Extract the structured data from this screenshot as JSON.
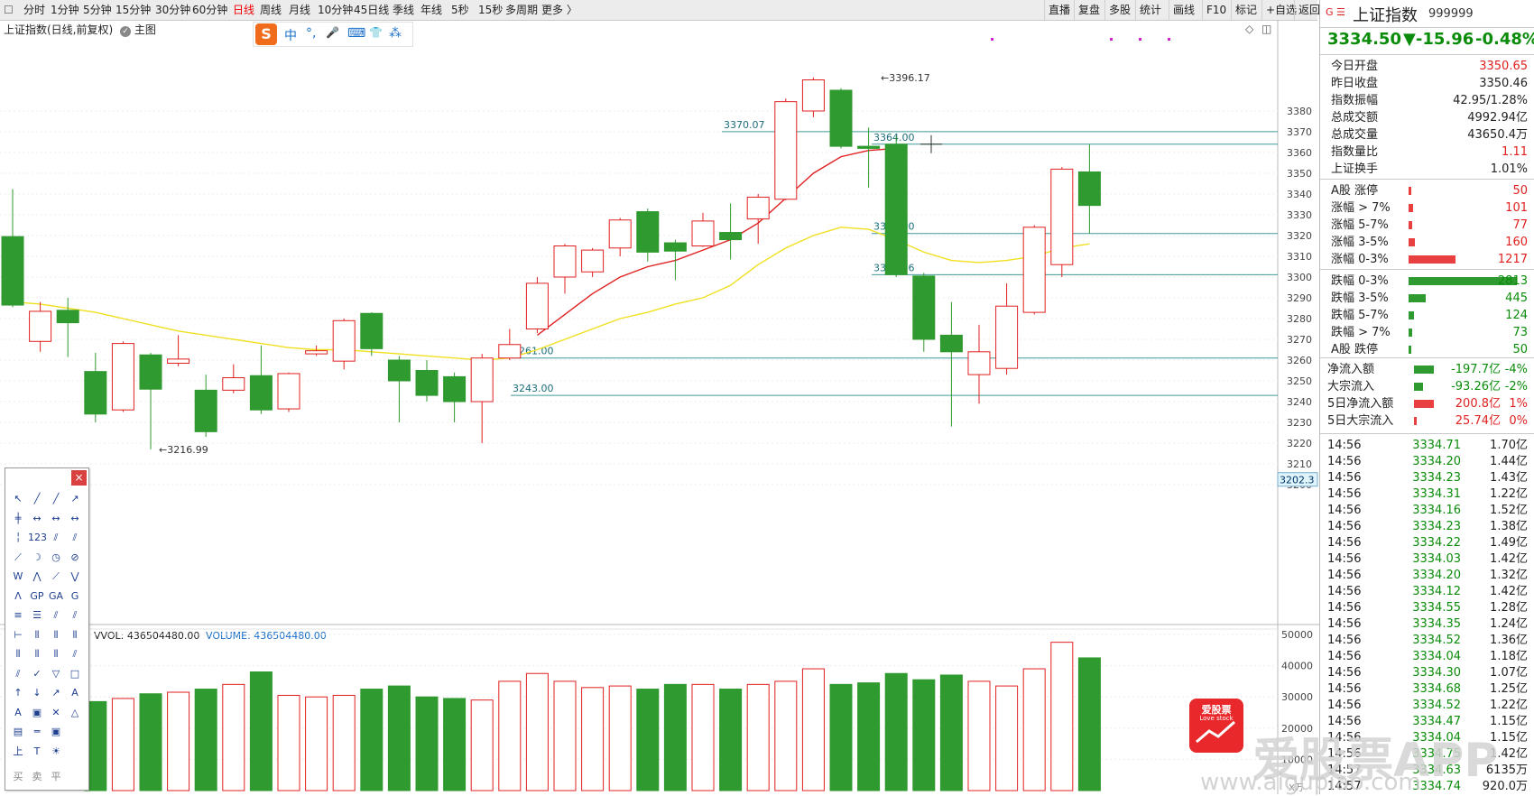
{
  "toolbar": {
    "periods": [
      "分时",
      "1分钟",
      "5分钟",
      "15分钟",
      "30分钟",
      "60分钟",
      "日线",
      "周线",
      "月线",
      "10分钟",
      "45日线",
      "季线",
      "年线",
      "5秒",
      "15秒",
      "多周期",
      "更多 〉"
    ],
    "active_period": "日线",
    "right_buttons": [
      "直播",
      "复盘",
      "多股",
      "统计",
      "画线",
      "F10",
      "标记",
      "+自选",
      "返回"
    ]
  },
  "chart": {
    "title": "上证指数(日线,前复权)",
    "main_label": "主图",
    "candles": [
      {
        "o": 3319.5,
        "c": 3286.5,
        "h": 3342.4,
        "l": 3285.5
      },
      {
        "o": 3269.0,
        "c": 3283.5,
        "h": 3288.0,
        "l": 3264.0
      },
      {
        "o": 3284.0,
        "c": 3278.0,
        "h": 3290.0,
        "l": 3261.5
      },
      {
        "o": 3254.5,
        "c": 3234.0,
        "h": 3263.5,
        "l": 3230.0
      },
      {
        "o": 3236.0,
        "c": 3268.0,
        "h": 3269.0,
        "l": 3235.0
      },
      {
        "o": 3262.5,
        "c": 3246.0,
        "h": 3263.5,
        "l": 3216.99
      },
      {
        "o": 3258.5,
        "c": 3260.5,
        "h": 3272.0,
        "l": 3257.0
      },
      {
        "o": 3245.5,
        "c": 3225.5,
        "h": 3253.0,
        "l": 3223.0
      },
      {
        "o": 3245.5,
        "c": 3251.5,
        "h": 3258.0,
        "l": 3244.0
      },
      {
        "o": 3252.5,
        "c": 3236.0,
        "h": 3267.0,
        "l": 3234.0
      },
      {
        "o": 3236.5,
        "c": 3253.5,
        "h": 3254.0,
        "l": 3235.0
      },
      {
        "o": 3263.0,
        "c": 3264.5,
        "h": 3267.0,
        "l": 3262.0
      },
      {
        "o": 3259.5,
        "c": 3279.0,
        "h": 3280.0,
        "l": 3255.5
      },
      {
        "o": 3282.5,
        "c": 3265.5,
        "h": 3283.0,
        "l": 3262.0
      },
      {
        "o": 3260.0,
        "c": 3250.0,
        "h": 3262.0,
        "l": 3230.0
      },
      {
        "o": 3255.0,
        "c": 3243.0,
        "h": 3260.0,
        "l": 3240.0
      },
      {
        "o": 3252.0,
        "c": 3240.0,
        "h": 3254.0,
        "l": 3230.0
      },
      {
        "o": 3240.0,
        "c": 3261.0,
        "h": 3263.0,
        "l": 3220.0
      },
      {
        "o": 3261.0,
        "c": 3267.5,
        "h": 3275.0,
        "l": 3260.0
      },
      {
        "o": 3275.0,
        "c": 3297.0,
        "h": 3300.0,
        "l": 3273.0
      },
      {
        "o": 3300.0,
        "c": 3315.0,
        "h": 3316.0,
        "l": 3292.0
      },
      {
        "o": 3302.5,
        "c": 3313.0,
        "h": 3314.0,
        "l": 3300.0
      },
      {
        "o": 3314.0,
        "c": 3327.5,
        "h": 3328.5,
        "l": 3310.0
      },
      {
        "o": 3331.5,
        "c": 3312.0,
        "h": 3333.0,
        "l": 3307.5
      },
      {
        "o": 3316.5,
        "c": 3312.5,
        "h": 3318.0,
        "l": 3298.5
      },
      {
        "o": 3315.0,
        "c": 3327.0,
        "h": 3331.0,
        "l": 3314.5
      },
      {
        "o": 3321.5,
        "c": 3318.0,
        "h": 3335.5,
        "l": 3308.5
      },
      {
        "o": 3328.0,
        "c": 3338.5,
        "h": 3340.0,
        "l": 3316.0
      },
      {
        "o": 3337.5,
        "c": 3384.5,
        "h": 3386.0,
        "l": 3337.0
      },
      {
        "o": 3380.0,
        "c": 3395.0,
        "h": 3396.17,
        "l": 3377.0
      },
      {
        "o": 3390.0,
        "c": 3363.0,
        "h": 3391.0,
        "l": 3362.0
      },
      {
        "o": 3363.0,
        "c": 3362.0,
        "h": 3372.0,
        "l": 3343.0
      },
      {
        "o": 3364.0,
        "c": 3301.16,
        "h": 3368.0,
        "l": 3300.0
      },
      {
        "o": 3300.5,
        "c": 3270.0,
        "h": 3302.0,
        "l": 3264.0
      },
      {
        "o": 3272.0,
        "c": 3264.0,
        "h": 3288.0,
        "l": 3228.0
      },
      {
        "o": 3253.0,
        "c": 3264.0,
        "h": 3277.0,
        "l": 3239.0
      },
      {
        "o": 3256.0,
        "c": 3286.0,
        "h": 3297.0,
        "l": 3253.0
      },
      {
        "o": 3283.0,
        "c": 3324.0,
        "h": 3325.0,
        "l": 3282.0
      },
      {
        "o": 3306.0,
        "c": 3352.0,
        "h": 3353.0,
        "l": 3300.0
      },
      {
        "o": 3350.65,
        "c": 3334.5,
        "h": 3364.0,
        "l": 3321.0
      }
    ],
    "volumes": [
      28500,
      29500,
      31000,
      31500,
      32500,
      34000,
      38000,
      30500,
      30000,
      30500,
      32500,
      33500,
      30000,
      29500,
      29000,
      35000,
      37500,
      35000,
      33000,
      33500,
      32500,
      34000,
      34000,
      32500,
      34000,
      35000,
      39000,
      34000,
      34500,
      37500,
      35500,
      37000,
      35000,
      33500,
      39000,
      47500,
      42500
    ],
    "y_labels": [
      "3380",
      "3370",
      "3360",
      "3350",
      "3340",
      "3330",
      "3320",
      "3310",
      "3300",
      "3290",
      "3280",
      "3270",
      "3260",
      "3250",
      "3240",
      "3230",
      "3220",
      "3210",
      "3200"
    ],
    "current_price_tag": "3202.3",
    "hlines": [
      {
        "label": "3370.07",
        "price": 3370.07
      },
      {
        "label": "3364.00",
        "price": 3364.0
      },
      {
        "label": "3321.00",
        "price": 3321.0
      },
      {
        "label": "3301.16",
        "price": 3301.16
      },
      {
        "label": "3261.00",
        "price": 3261.0
      },
      {
        "label": "3243.00",
        "price": 3243.0
      }
    ],
    "high_annotation": "3396.17",
    "low_annotation": "3216.99",
    "vol_label": "VVOL: 436504480.00",
    "volume_label": "VOLUME: 436504480.00",
    "vol_y_labels": [
      "50000",
      "40000",
      "30000",
      "20000",
      "10000"
    ],
    "vol_unit": "X万",
    "ma_short": [
      null,
      null,
      null,
      null,
      null,
      null,
      null,
      null,
      null,
      null,
      null,
      null,
      null,
      null,
      null,
      null,
      null,
      null,
      null,
      3272,
      3282,
      3292,
      3300,
      3305,
      3308,
      3313,
      3318,
      3326,
      3338,
      3350,
      3358,
      3361,
      3362
    ],
    "ma_long": [
      3288,
      3287,
      3285,
      3283,
      3280,
      3277,
      3274,
      3272,
      3270,
      3268,
      3266,
      3265,
      3265,
      3264,
      3263,
      3262,
      3261,
      3260,
      3261,
      3265,
      3270,
      3275,
      3280,
      3283,
      3287,
      3290,
      3296,
      3306,
      3314,
      3320,
      3324,
      3323,
      3318,
      3312,
      3308,
      3307,
      3308,
      3310,
      3314,
      3316
    ]
  },
  "ime": {
    "logo": "S",
    "items": [
      "中",
      "°,",
      "🎤",
      "⌨",
      "👕",
      "⁂"
    ]
  },
  "side": {
    "header_marks": "G ☰",
    "name": "上证指数",
    "code": "999999",
    "price": "3334.50",
    "change": "▼-15.96",
    "change_pct": "-0.48%",
    "stats": [
      {
        "label": "今日开盘",
        "value": "3350.65",
        "color": "red"
      },
      {
        "label": "昨日收盘",
        "value": "3350.46",
        "color": "black"
      },
      {
        "label": "指数振幅",
        "value": "42.95/1.28%",
        "color": "black"
      },
      {
        "label": "总成交额",
        "value": "4992.94亿",
        "color": "black"
      },
      {
        "label": "总成交量",
        "value": "43650.4万",
        "color": "black"
      },
      {
        "label": "指数量比",
        "value": "1.11",
        "color": "red"
      },
      {
        "label": "上证换手",
        "value": "1.01%",
        "color": "black"
      }
    ],
    "breadth": [
      {
        "label": "A股 涨停",
        "value": "50",
        "color": "red",
        "frac": 0.02
      },
      {
        "label": "涨幅 > 7%",
        "value": "101",
        "color": "red",
        "frac": 0.04
      },
      {
        "label": "涨幅 5-7%",
        "value": "77",
        "color": "red",
        "frac": 0.03
      },
      {
        "label": "涨幅 3-5%",
        "value": "160",
        "color": "red",
        "frac": 0.06
      },
      {
        "label": "涨幅 0-3%",
        "value": "1217",
        "color": "red",
        "frac": 0.43
      },
      {
        "label": "跌幅 0-3%",
        "value": "2813",
        "color": "green",
        "frac": 1.0
      },
      {
        "label": "跌幅 3-5%",
        "value": "445",
        "color": "green",
        "frac": 0.16
      },
      {
        "label": "跌幅 5-7%",
        "value": "124",
        "color": "green",
        "frac": 0.05
      },
      {
        "label": "跌幅 > 7%",
        "value": "73",
        "color": "green",
        "frac": 0.03
      },
      {
        "label": "A股 跌停",
        "value": "50",
        "color": "green",
        "frac": 0.02
      }
    ],
    "flows": [
      {
        "label": "净流入额",
        "value": "-197.7亿",
        "pct": "-4%",
        "color": "green",
        "frac": 0.55
      },
      {
        "label": "大宗流入",
        "value": "-93.26亿",
        "pct": "-2%",
        "color": "green",
        "frac": 0.25
      },
      {
        "label": "5日净流入额",
        "value": "200.8亿",
        "pct": "1%",
        "color": "red",
        "frac": 0.55
      },
      {
        "label": "5日大宗流入",
        "value": "25.74亿",
        "pct": "0%",
        "color": "red",
        "frac": 0.07
      }
    ],
    "ticks": [
      {
        "time": "14:56",
        "price": "3334.71",
        "vol": "1.70亿"
      },
      {
        "time": "14:56",
        "price": "3334.20",
        "vol": "1.44亿"
      },
      {
        "time": "14:56",
        "price": "3334.23",
        "vol": "1.43亿"
      },
      {
        "time": "14:56",
        "price": "3334.31",
        "vol": "1.22亿"
      },
      {
        "time": "14:56",
        "price": "3334.16",
        "vol": "1.52亿"
      },
      {
        "time": "14:56",
        "price": "3334.23",
        "vol": "1.38亿"
      },
      {
        "time": "14:56",
        "price": "3334.22",
        "vol": "1.49亿"
      },
      {
        "time": "14:56",
        "price": "3334.03",
        "vol": "1.42亿"
      },
      {
        "time": "14:56",
        "price": "3334.20",
        "vol": "1.32亿"
      },
      {
        "time": "14:56",
        "price": "3334.12",
        "vol": "1.42亿"
      },
      {
        "time": "14:56",
        "price": "3334.55",
        "vol": "1.28亿"
      },
      {
        "time": "14:56",
        "price": "3334.35",
        "vol": "1.24亿"
      },
      {
        "time": "14:56",
        "price": "3334.52",
        "vol": "1.36亿"
      },
      {
        "time": "14:56",
        "price": "3334.04",
        "vol": "1.18亿"
      },
      {
        "time": "14:56",
        "price": "3334.30",
        "vol": "1.07亿"
      },
      {
        "time": "14:56",
        "price": "3334.68",
        "vol": "1.25亿"
      },
      {
        "time": "14:56",
        "price": "3334.52",
        "vol": "1.22亿"
      },
      {
        "time": "14:56",
        "price": "3334.47",
        "vol": "1.15亿"
      },
      {
        "time": "14:56",
        "price": "3334.04",
        "vol": "1.15亿"
      },
      {
        "time": "14:56",
        "price": "3334.75",
        "vol": "1.42亿"
      },
      {
        "time": "14:57",
        "price": "3334.63",
        "vol": "6135万"
      },
      {
        "time": "14:57",
        "price": "3334.74",
        "vol": "920.0万"
      }
    ]
  },
  "toolbox": {
    "close": "×",
    "icons": [
      "↖",
      "╱",
      "╱",
      "↗",
      "╪",
      "↔",
      "↔",
      "↔",
      "╎",
      "123",
      "⫽",
      "⫽",
      "⟋",
      "☽",
      "◷",
      "⊘",
      "W",
      "⋀",
      "⟋",
      "⋁",
      "ᐱ",
      "GP",
      "GA",
      "G",
      "≡",
      "☰",
      "⫽",
      "⫽",
      "⊢",
      "⦀",
      "⦀",
      "⦀",
      "⦀",
      "⦀",
      "⦀",
      "⫽",
      "⫽",
      "✓",
      "▽",
      "□",
      "↑",
      "↓",
      "↗",
      "A",
      "A",
      "▣",
      "✕",
      "△",
      "▤",
      "═",
      "▣",
      "",
      "上",
      "T",
      "☀",
      ""
    ],
    "bottom_labels": [
      "买",
      "卖",
      "平"
    ]
  },
  "ad": {
    "brand": "爱股票",
    "slogan": "Love stock",
    "watermark": "爱股票APP",
    "url": "www.aigupiao.com"
  }
}
